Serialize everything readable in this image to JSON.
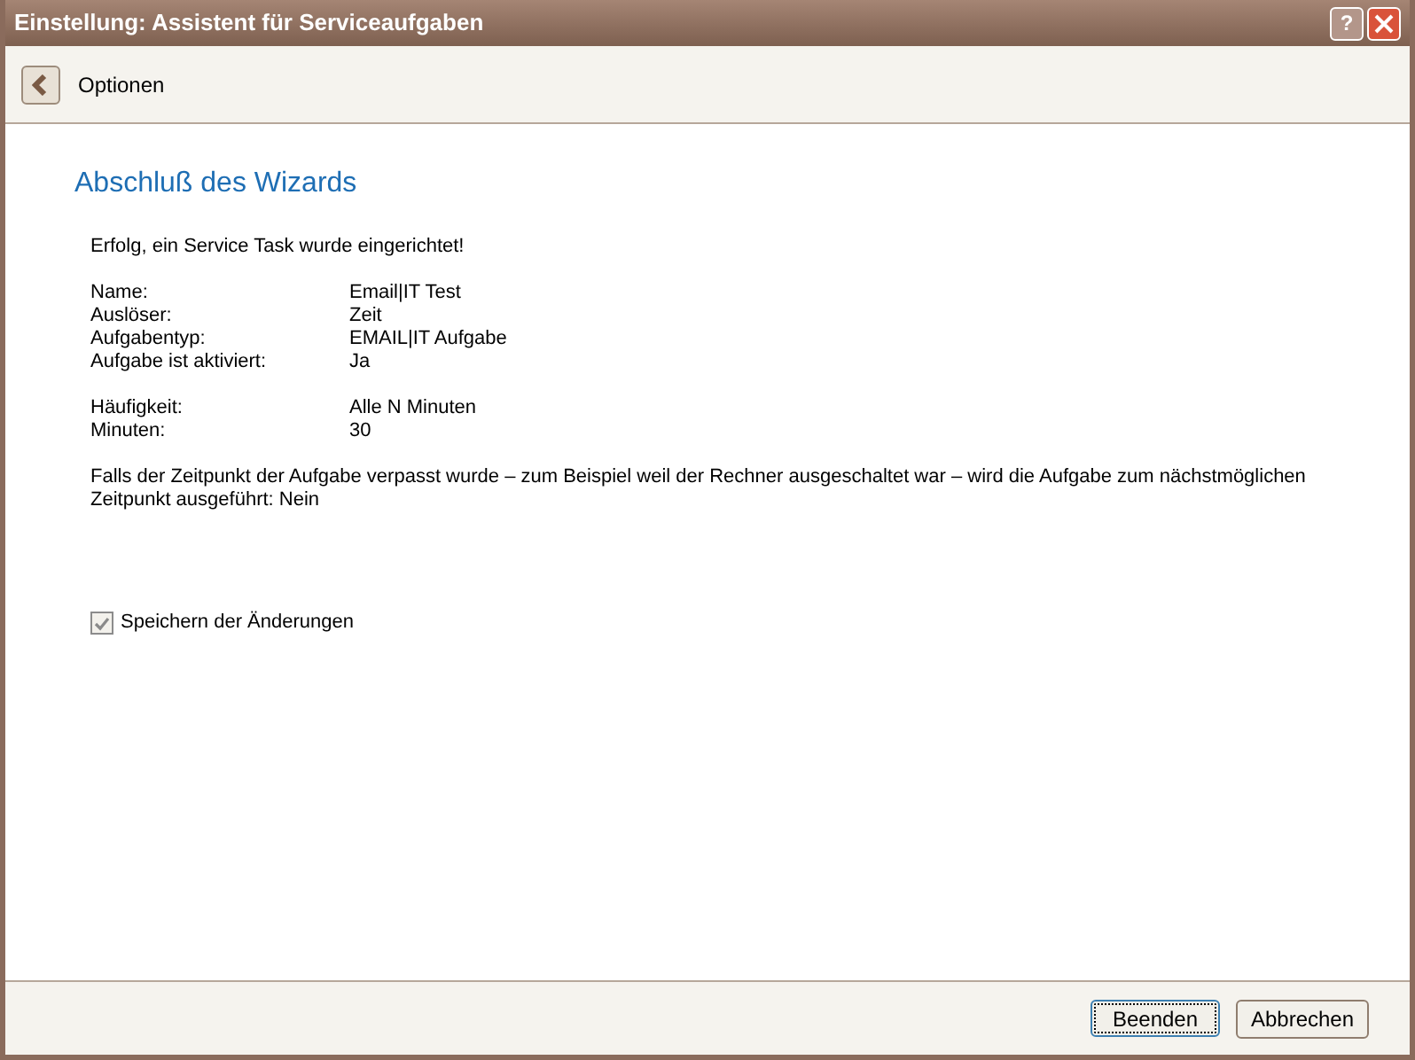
{
  "window": {
    "title": "Einstellung: Assistent für Serviceaufgaben",
    "help_button": "?"
  },
  "toolbar": {
    "title": "Optionen"
  },
  "heading": "Abschluß des Wizards",
  "success_message": "Erfolg, ein Service Task wurde eingerichtet!",
  "groups": [
    [
      {
        "label": "Name:",
        "value": "Email|IT Test"
      },
      {
        "label": "Auslöser:",
        "value": "Zeit"
      },
      {
        "label": "Aufgabentyp:",
        "value": "EMAIL|IT Aufgabe"
      },
      {
        "label": "Aufgabe ist aktiviert:",
        "value": "Ja"
      }
    ],
    [
      {
        "label": "Häufigkeit:",
        "value": "Alle N Minuten"
      },
      {
        "label": "Minuten:",
        "value": "30"
      }
    ]
  ],
  "note": "Falls der Zeitpunkt der Aufgabe verpasst wurde – zum Beispiel weil der Rechner ausgeschaltet war – wird die Aufgabe zum nächstmöglichen Zeitpunkt ausgeführt: Nein",
  "save_checkbox": {
    "label": "Speichern der Änderungen",
    "checked": true
  },
  "buttons": [
    {
      "label": "Beenden",
      "selected": true
    },
    {
      "label": "Abbrechen",
      "selected": false
    }
  ]
}
